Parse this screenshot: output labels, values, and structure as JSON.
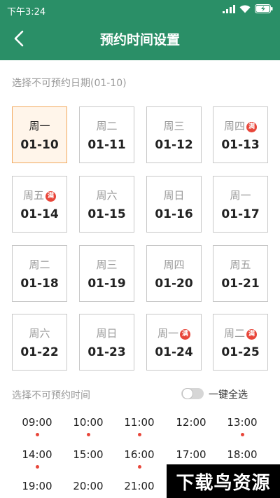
{
  "status_bar": {
    "time": "下午3:24",
    "battery_icon": "battery-charging-icon",
    "wifi_icon": "wifi-icon",
    "signal_icon": "signal-icon"
  },
  "header": {
    "title": "预约时间设置",
    "back_icon": "back-arrow-icon"
  },
  "colors": {
    "primary": "#2a8f67",
    "selected_border": "#f2a95e",
    "badge": "#e8463a"
  },
  "date_section": {
    "label": "选择不可预约日期(01-10)",
    "dates": [
      {
        "weekday": "周一",
        "date": "01-10",
        "full": false,
        "selected": true
      },
      {
        "weekday": "周二",
        "date": "01-11",
        "full": false,
        "selected": false
      },
      {
        "weekday": "周三",
        "date": "01-12",
        "full": false,
        "selected": false
      },
      {
        "weekday": "周四",
        "date": "01-13",
        "full": true,
        "selected": false
      },
      {
        "weekday": "周五",
        "date": "01-14",
        "full": true,
        "selected": false
      },
      {
        "weekday": "周六",
        "date": "01-15",
        "full": false,
        "selected": false
      },
      {
        "weekday": "周日",
        "date": "01-16",
        "full": false,
        "selected": false
      },
      {
        "weekday": "周一",
        "date": "01-17",
        "full": false,
        "selected": false
      },
      {
        "weekday": "周二",
        "date": "01-18",
        "full": false,
        "selected": false
      },
      {
        "weekday": "周三",
        "date": "01-19",
        "full": false,
        "selected": false
      },
      {
        "weekday": "周四",
        "date": "01-20",
        "full": false,
        "selected": false
      },
      {
        "weekday": "周五",
        "date": "01-21",
        "full": false,
        "selected": false
      },
      {
        "weekday": "周六",
        "date": "01-22",
        "full": false,
        "selected": false
      },
      {
        "weekday": "周日",
        "date": "01-23",
        "full": false,
        "selected": false
      },
      {
        "weekday": "周一",
        "date": "01-24",
        "full": true,
        "selected": false
      },
      {
        "weekday": "周二",
        "date": "01-25",
        "full": true,
        "selected": false
      }
    ],
    "full_badge": "满"
  },
  "time_section": {
    "label": "选择不可预约时间",
    "select_all_label": "一键全选",
    "select_all_on": false,
    "slots": [
      {
        "time": "09:00",
        "dot": true
      },
      {
        "time": "10:00",
        "dot": true
      },
      {
        "time": "11:00",
        "dot": true
      },
      {
        "time": "12:00",
        "dot": false
      },
      {
        "time": "13:00",
        "dot": true
      },
      {
        "time": "14:00",
        "dot": true
      },
      {
        "time": "15:00",
        "dot": false
      },
      {
        "time": "16:00",
        "dot": true
      },
      {
        "time": "17:00",
        "dot": false
      },
      {
        "time": "18:00",
        "dot": true
      },
      {
        "time": "19:00",
        "dot": false
      },
      {
        "time": "20:00",
        "dot": false
      },
      {
        "time": "21:00",
        "dot": false
      }
    ]
  },
  "watermark": "下载鸟资源"
}
